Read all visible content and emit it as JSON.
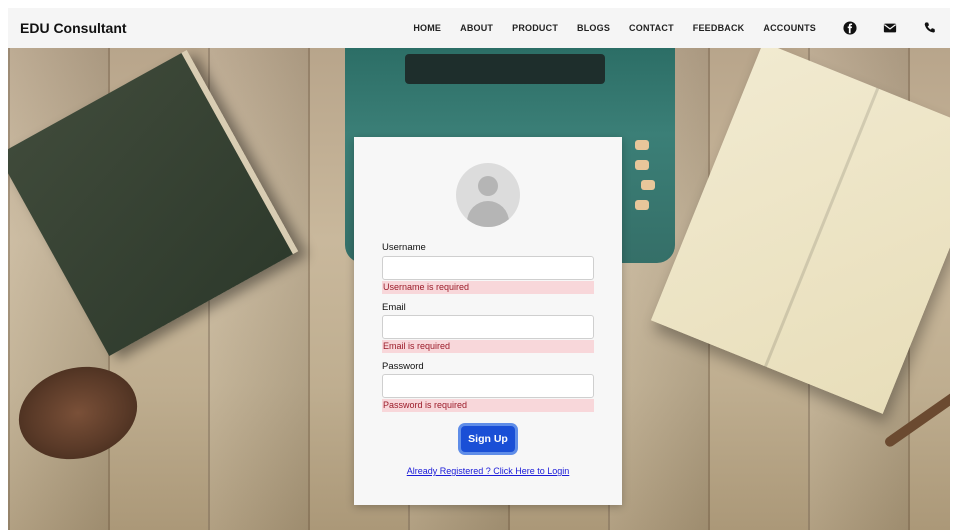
{
  "navbar": {
    "brand": "EDU Consultant",
    "links": [
      "HOME",
      "ABOUT",
      "PRODUCT",
      "BLOGS",
      "CONTACT",
      "FEEDBACK",
      "ACCOUNTS"
    ],
    "icons": [
      "facebook-icon",
      "envelope-icon",
      "phone-icon"
    ]
  },
  "form": {
    "username": {
      "label": "Username",
      "value": "",
      "error": "Username is required"
    },
    "email": {
      "label": "Email",
      "value": "",
      "error": "Email is required"
    },
    "password": {
      "label": "Password",
      "value": "",
      "error": "Password is required"
    },
    "submit_label": "Sign Up",
    "login_link": "Already Registered ? Click Here to Login"
  },
  "colors": {
    "accent": "#1a4fd6",
    "error_bg": "#f8d7da",
    "error_text": "#9b1c2a",
    "link": "#1a1ad8"
  }
}
